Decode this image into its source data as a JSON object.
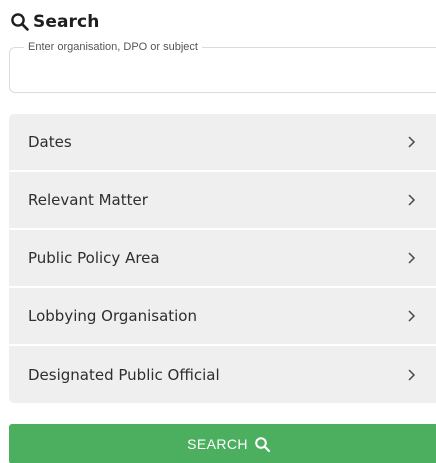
{
  "heading": {
    "title": "Search",
    "icon": "search-icon"
  },
  "search": {
    "legend": "Enter organisation, DPO or subject",
    "value": "",
    "placeholder": ""
  },
  "filters": [
    {
      "label": "Dates",
      "icon": "chevron-right-icon"
    },
    {
      "label": "Relevant Matter",
      "icon": "chevron-right-icon"
    },
    {
      "label": "Public Policy Area",
      "icon": "chevron-right-icon"
    },
    {
      "label": "Lobbying Organisation",
      "icon": "chevron-right-icon"
    },
    {
      "label": "Designated Public Official",
      "icon": "chevron-right-icon"
    }
  ],
  "submit": {
    "label": "SEARCH",
    "icon": "search-icon",
    "color": "#4caf60"
  }
}
